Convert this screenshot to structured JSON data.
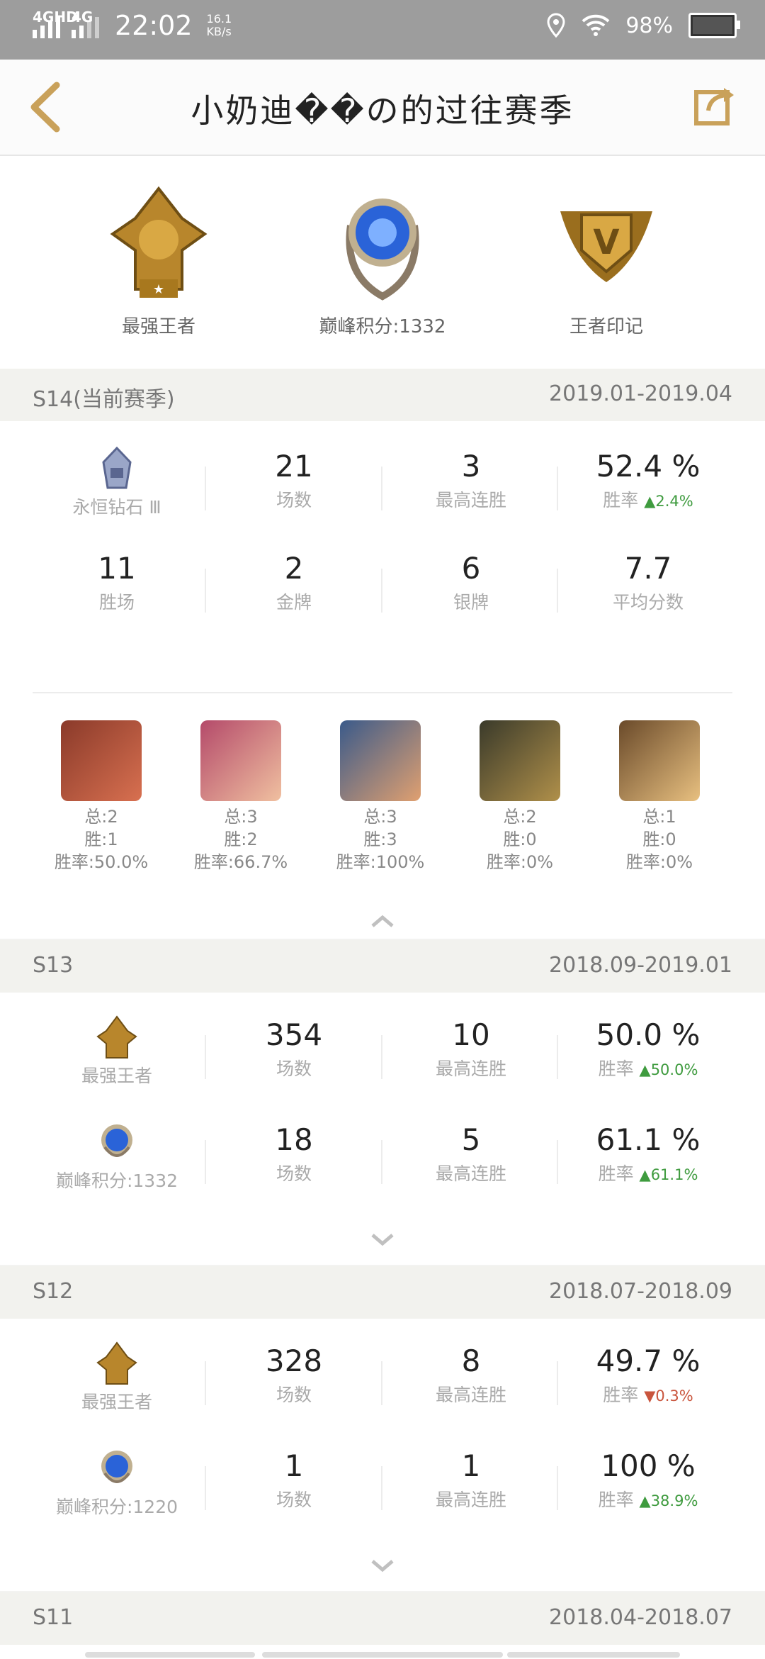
{
  "status_bar": {
    "network1": "4GHD",
    "network2": "4G",
    "time": "22:02",
    "speed_value": "16.1",
    "speed_unit": "KB/s",
    "battery": "98%"
  },
  "header": {
    "title": "小奶迪��の的过往赛季"
  },
  "summary_badges": [
    {
      "label": "最强王者",
      "icon": "king-rank-icon"
    },
    {
      "label": "巅峰积分:1332",
      "icon": "peak-score-icon"
    },
    {
      "label": "王者印记",
      "icon": "king-mark-icon"
    }
  ],
  "seasons": [
    {
      "name": "S14(当前赛季)",
      "dates": "2019.01-2019.04",
      "row1": [
        {
          "label": "永恒钻石 Ⅲ"
        },
        {
          "value": "21",
          "label": "场数"
        },
        {
          "value": "3",
          "label": "最高连胜"
        },
        {
          "value": "52.4 %",
          "label": "胜率",
          "delta": "▲2.4%"
        }
      ],
      "row2": [
        {
          "value": "11",
          "label": "胜场"
        },
        {
          "value": "2",
          "label": "金牌"
        },
        {
          "value": "6",
          "label": "银牌"
        },
        {
          "value": "7.7",
          "label": "平均分数"
        }
      ],
      "heroes": [
        {
          "total": "总:2",
          "wins": "胜:1",
          "rate": "胜率:50.0%",
          "color1": "#8a3a2a",
          "color2": "#d87050"
        },
        {
          "total": "总:3",
          "wins": "胜:2",
          "rate": "胜率:66.7%",
          "color1": "#b44a6a",
          "color2": "#f0c0a0"
        },
        {
          "total": "总:3",
          "wins": "胜:3",
          "rate": "胜率:100%",
          "color1": "#3a5a8a",
          "color2": "#e0a070"
        },
        {
          "total": "总:2",
          "wins": "胜:0",
          "rate": "胜率:0%",
          "color1": "#3a3a2a",
          "color2": "#b0904a"
        },
        {
          "total": "总:1",
          "wins": "胜:0",
          "rate": "胜率:0%",
          "color1": "#6a4a2a",
          "color2": "#e8c080"
        }
      ]
    },
    {
      "name": "S13",
      "dates": "2018.09-2019.01",
      "rows": [
        [
          {
            "label": "最强王者"
          },
          {
            "value": "354",
            "label": "场数"
          },
          {
            "value": "10",
            "label": "最高连胜"
          },
          {
            "value": "50.0 %",
            "label": "胜率",
            "delta": "▲50.0%"
          }
        ],
        [
          {
            "label": "巅峰积分:1332"
          },
          {
            "value": "18",
            "label": "场数"
          },
          {
            "value": "5",
            "label": "最高连胜"
          },
          {
            "value": "61.1 %",
            "label": "胜率",
            "delta": "▲61.1%"
          }
        ]
      ]
    },
    {
      "name": "S12",
      "dates": "2018.07-2018.09",
      "rows": [
        [
          {
            "label": "最强王者"
          },
          {
            "value": "328",
            "label": "场数"
          },
          {
            "value": "8",
            "label": "最高连胜"
          },
          {
            "value": "49.7 %",
            "label": "胜率",
            "delta": "▼0.3%"
          }
        ],
        [
          {
            "label": "巅峰积分:1220"
          },
          {
            "value": "1",
            "label": "场数"
          },
          {
            "value": "1",
            "label": "最高连胜"
          },
          {
            "value": "100 %",
            "label": "胜率",
            "delta": "▲38.9%"
          }
        ]
      ]
    },
    {
      "name": "S11",
      "dates": "2018.04-2018.07"
    }
  ],
  "colors": {
    "accent": "#c9a15a",
    "up": "#3f9b3f",
    "down": "#c9553d"
  }
}
